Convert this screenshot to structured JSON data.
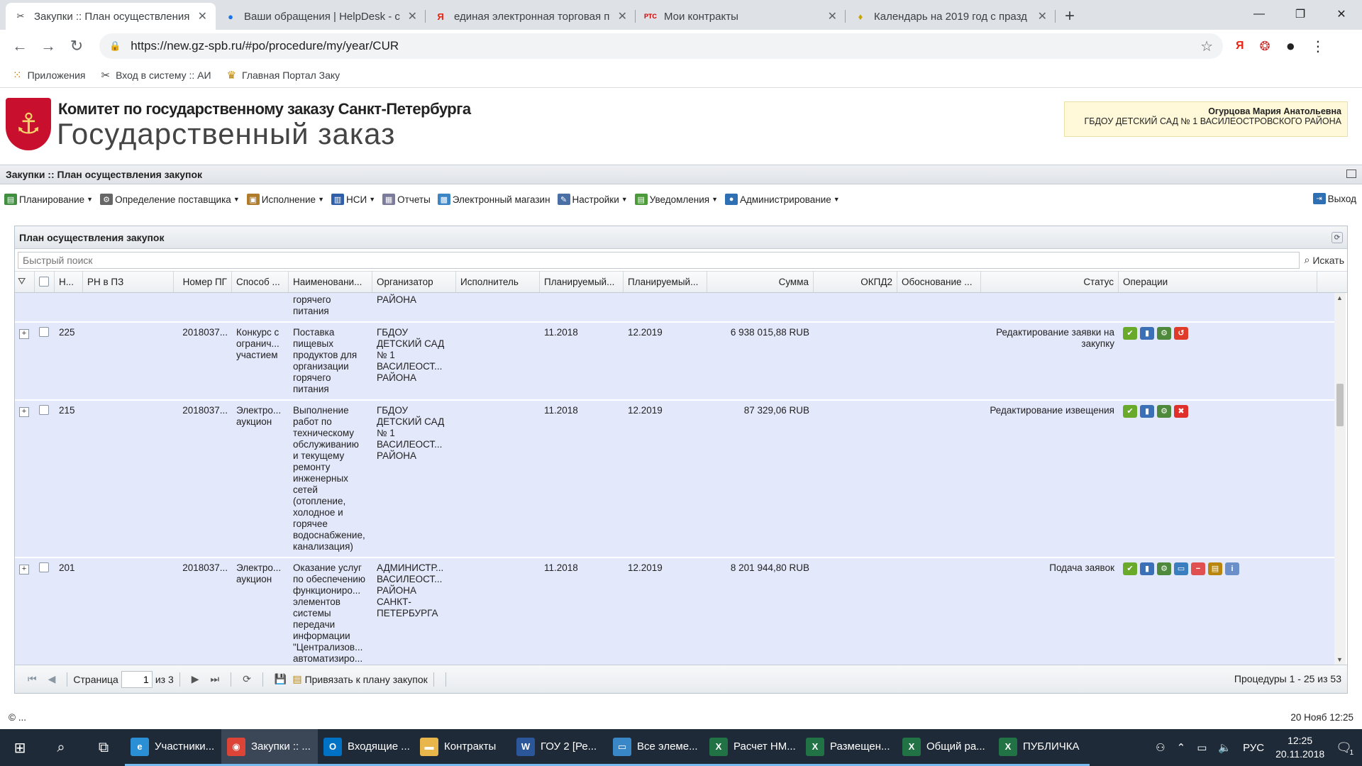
{
  "browser": {
    "tabs": [
      {
        "title": "Закупки :: План осуществления",
        "icon": "tools-icon",
        "active": true
      },
      {
        "title": "Ваши обращения | HelpDesk - с",
        "icon": "globe-icon",
        "active": false
      },
      {
        "title": "единая электронная торговая п",
        "icon": "yandex-icon",
        "active": false
      },
      {
        "title": "Мои контракты",
        "icon": "rts-icon",
        "active": false
      },
      {
        "title": "Календарь на 2019 год с празд",
        "icon": "bulb-icon",
        "active": false
      }
    ],
    "url": "https://new.gz-spb.ru/#po/procedure/my/year/CUR",
    "bookmarks": [
      {
        "label": "Приложения",
        "icon": "apps-grid-icon"
      },
      {
        "label": "Вход в систему :: АИ",
        "icon": "tools-icon"
      },
      {
        "label": "Главная Портал Заку",
        "icon": "coat-of-arms-icon"
      }
    ]
  },
  "site": {
    "org_line": "Комитет по государственному заказу Санкт-Петербурга",
    "brand": "Государственный заказ",
    "user_name": "Огурцова Мария Анатольевна",
    "user_org": "ГБДОУ ДЕТСКИЙ САД № 1 ВАСИЛЕОСТРОВСКОГО РАЙОНА"
  },
  "app": {
    "title": "Закупки :: План осуществления закупок",
    "menu": [
      {
        "label": "Планирование",
        "dropdown": true,
        "icon": "planning-icon",
        "color": "#3f8f3f"
      },
      {
        "label": "Определение поставщика",
        "dropdown": true,
        "icon": "gear-icon",
        "color": "#666666"
      },
      {
        "label": "Исполнение",
        "dropdown": true,
        "icon": "execution-icon",
        "color": "#b07b2a"
      },
      {
        "label": "НСИ",
        "dropdown": true,
        "icon": "book-icon",
        "color": "#2f5fa8"
      },
      {
        "label": "Отчеты",
        "dropdown": false,
        "icon": "report-icon",
        "color": "#7b7b9b"
      },
      {
        "label": "Электронный магазин",
        "dropdown": false,
        "icon": "cart-icon",
        "color": "#3d86c6"
      },
      {
        "label": "Настройки",
        "dropdown": true,
        "icon": "wrench-icon",
        "color": "#4a6fa5"
      },
      {
        "label": "Уведомления",
        "dropdown": true,
        "icon": "notification-icon",
        "color": "#4c9a3b"
      },
      {
        "label": "Администрирование",
        "dropdown": true,
        "icon": "user-icon",
        "color": "#2f6fb4"
      }
    ],
    "logout_label": "Выход"
  },
  "grid": {
    "title": "План осуществления закупок",
    "search_placeholder": "Быстрый поиск",
    "search_button": "Искать",
    "columns": [
      "Н...",
      "РН в ПЗ",
      "Номер ПГ",
      "Способ ...",
      "Наименовани...",
      "Организатор",
      "Исполнитель",
      "Планируемый...",
      "Планируемый...",
      "Сумма",
      "ОКПД2",
      "Обоснование ...",
      "Статус",
      "Операции"
    ],
    "partial_row": {
      "name": "горячего\nпитания",
      "organizer": "РАЙОНА"
    },
    "rows": [
      {
        "num": "225",
        "pg": "2018037...",
        "method": "Конкурс с\nогранич...\nучастием",
        "name": "Поставка\nпищевых\nпродуктов для\nорганизации\nгорячего\nпитания",
        "organizer": "ГБДОУ\nДЕТСКИЙ САД\n№ 1\nВАСИЛЕОСТ...\nРАЙОНА",
        "plan1": "11.2018",
        "plan2": "12.2019",
        "sum": "6 938 015,88 RUB",
        "status": "Редактирование заявки на\nзакупку",
        "ops": [
          "approve-icon",
          "chart-icon",
          "settings-icon",
          "undo-icon"
        ]
      },
      {
        "num": "215",
        "pg": "2018037...",
        "method": "Электро...\nаукцион",
        "name": "Выполнение\nработ по\nтехническому\nобслуживанию\nи текущему\nремонту\nинженерных\nсетей\n(отопление,\nхолодное и\nгорячее\nводоснабжение,\nканализация)",
        "organizer": "ГБДОУ\nДЕТСКИЙ САД\n№ 1\nВАСИЛЕОСТ...\nРАЙОНА",
        "plan1": "11.2018",
        "plan2": "12.2019",
        "sum": "87 329,06 RUB",
        "status": "Редактирование извещения",
        "ops": [
          "approve-icon",
          "chart-icon",
          "settings-icon",
          "delete-icon"
        ]
      },
      {
        "num": "201",
        "pg": "2018037...",
        "method": "Электро...\nаукцион",
        "name": "Оказание услуг\nпо обеспечению\nфункциониро...\nэлементов\nсистемы\nпередачи\nинформации\n\"Централизов...\nавтоматизиро...\nсистема",
        "organizer": "АДМИНИСТР...\nВАСИЛЕОСТ...\nРАЙОНА\nСАНКТ-\nПЕТЕРБУРГА",
        "plan1": "11.2018",
        "plan2": "12.2019",
        "sum": "8 201 944,80 RUB",
        "status": "Подача заявок",
        "ops": [
          "approve-icon",
          "chart-icon",
          "settings-icon",
          "monitor-icon",
          "stop-icon",
          "link-plan-icon",
          "info-icon"
        ]
      }
    ],
    "pager": {
      "page_label": "Страница",
      "page_value": "1",
      "of_label": "из 3",
      "link_plan": "Привязать к плану закупок",
      "info": "Процедуры 1 - 25 из 53"
    }
  },
  "footer": {
    "left": "© ...",
    "right": "20 Нояб 12:25"
  },
  "taskbar": {
    "apps": [
      {
        "label": "Участники...",
        "icon": "ie-icon",
        "color": "#2b8fd6",
        "active": false
      },
      {
        "label": "Закупки :: ...",
        "icon": "chrome-icon",
        "color": "#db4437",
        "active": true
      },
      {
        "label": "Входящие ...",
        "icon": "outlook-icon",
        "color": "#0072c6",
        "active": false
      },
      {
        "label": "Контракты",
        "icon": "folder-icon",
        "color": "#e8b64a",
        "active": false
      },
      {
        "label": "ГОУ 2 [Ре...",
        "icon": "word-icon",
        "color": "#2b579a",
        "active": false
      },
      {
        "label": "Все элеме...",
        "icon": "window-icon",
        "color": "#3a87c8",
        "active": false
      },
      {
        "label": "Расчет НМ...",
        "icon": "excel-icon",
        "color": "#217346",
        "active": false
      },
      {
        "label": "Размещен...",
        "icon": "excel-icon",
        "color": "#217346",
        "active": false
      },
      {
        "label": "Общий ра...",
        "icon": "excel-icon",
        "color": "#217346",
        "active": false
      },
      {
        "label": "ПУБЛИЧКА",
        "icon": "excel-icon",
        "color": "#217346",
        "active": false
      }
    ],
    "lang": "РУС",
    "time": "12:25",
    "date": "20.11.2018",
    "notification_count": "1"
  }
}
